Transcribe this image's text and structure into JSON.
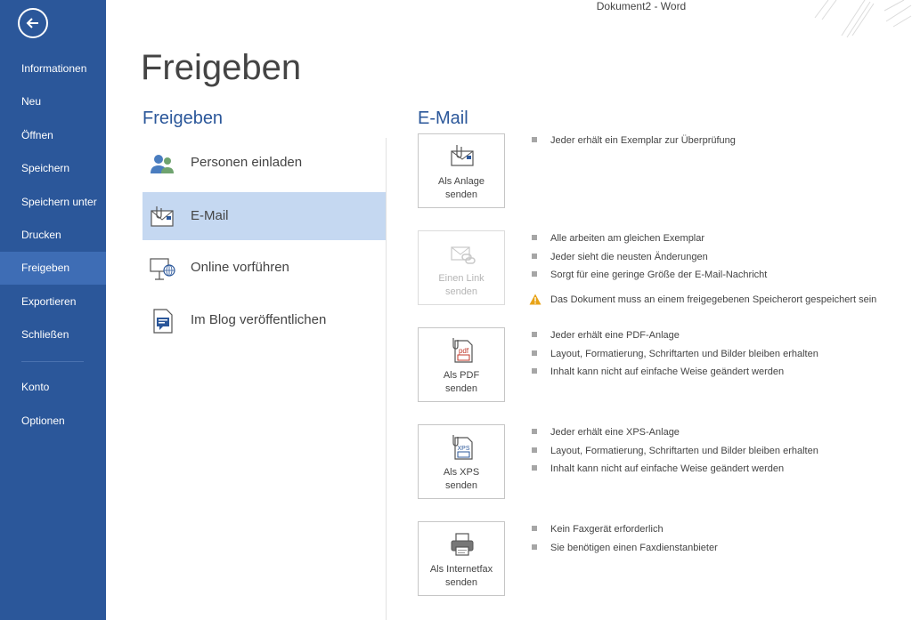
{
  "window": {
    "title": "Dokument2 - Word"
  },
  "sidebar": {
    "items": [
      {
        "label": "Informationen"
      },
      {
        "label": "Neu"
      },
      {
        "label": "Öffnen"
      },
      {
        "label": "Speichern"
      },
      {
        "label": "Speichern unter"
      },
      {
        "label": "Drucken"
      },
      {
        "label": "Freigeben"
      },
      {
        "label": "Exportieren"
      },
      {
        "label": "Schließen"
      },
      {
        "label": "Konto"
      },
      {
        "label": "Optionen"
      }
    ],
    "active": "Freigeben"
  },
  "main": {
    "title": "Freigeben",
    "section_heading": "Freigeben",
    "share_options": [
      {
        "label": "Personen einladen",
        "icon": "people-icon"
      },
      {
        "label": "E-Mail",
        "icon": "email-icon"
      },
      {
        "label": "Online vorführen",
        "icon": "presentation-icon"
      },
      {
        "label": "Im Blog veröffentlichen",
        "icon": "blog-icon"
      }
    ],
    "selected_option": "E-Mail"
  },
  "email": {
    "heading": "E-Mail",
    "actions": [
      {
        "label_line1": "Als Anlage",
        "label_line2": "senden",
        "icon": "attachment-icon",
        "enabled": true,
        "bullets": [
          "Jeder erhält ein Exemplar zur Überprüfung"
        ]
      },
      {
        "label_line1": "Einen Link",
        "label_line2": "senden",
        "icon": "link-icon",
        "enabled": false,
        "bullets": [
          "Alle arbeiten am gleichen Exemplar",
          "Jeder sieht die neusten Änderungen",
          "Sorgt für eine geringe Größe der E-Mail-Nachricht"
        ],
        "warning": "Das Dokument muss an einem freigegebenen Speicherort gespeichert sein"
      },
      {
        "label_line1": "Als PDF",
        "label_line2": "senden",
        "icon": "pdf-icon",
        "icon_text": "pdf",
        "enabled": true,
        "bullets": [
          "Jeder erhält eine PDF-Anlage",
          "Layout, Formatierung, Schriftarten und Bilder bleiben erhalten",
          "Inhalt kann nicht auf einfache Weise geändert werden"
        ]
      },
      {
        "label_line1": "Als XPS",
        "label_line2": "senden",
        "icon": "xps-icon",
        "icon_text": "XPS",
        "enabled": true,
        "bullets": [
          "Jeder erhält eine XPS-Anlage",
          "Layout, Formatierung, Schriftarten und Bilder bleiben erhalten",
          "Inhalt kann nicht auf einfache Weise geändert werden"
        ]
      },
      {
        "label_line1": "Als Internetfax",
        "label_line2": "senden",
        "icon": "fax-icon",
        "enabled": true,
        "bullets": [
          "Kein Faxgerät erforderlich",
          "Sie benötigen einen Faxdienstanbieter"
        ]
      }
    ]
  },
  "colors": {
    "sidebar": "#2b579a",
    "sidebar_active": "#3e6db5",
    "accent": "#2b579a",
    "selected_option": "#c5d8f1"
  }
}
